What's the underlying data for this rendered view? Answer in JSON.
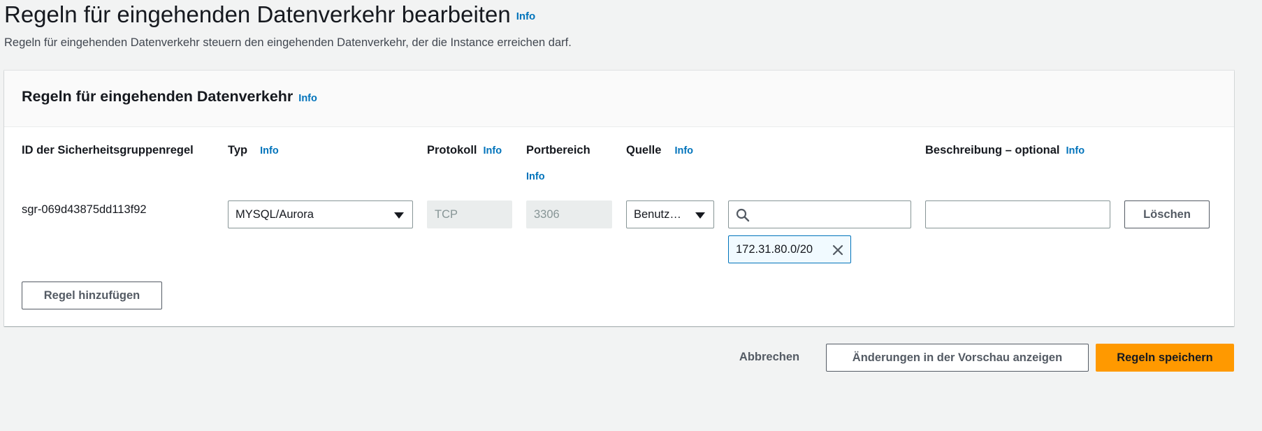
{
  "page": {
    "title": "Regeln für eingehenden Datenverkehr bearbeiten",
    "title_info": "Info",
    "description": "Regeln für eingehenden Datenverkehr steuern den eingehenden Datenverkehr, der die Instance erreichen darf."
  },
  "panel": {
    "title": "Regeln für eingehenden Datenverkehr",
    "title_info": "Info",
    "columns": {
      "rule_id": "ID der Sicherheitsgruppenregel",
      "type": "Typ",
      "type_info": "Info",
      "protocol": "Protokoll",
      "protocol_info": "Info",
      "port_range": "Portbereich",
      "port_range_info": "Info",
      "source": "Quelle",
      "source_info": "Info",
      "description": "Beschreibung – optional",
      "description_info": "Info"
    },
    "rule": {
      "id": "sgr-069d43875dd113f92",
      "type": "MYSQL/Aurora",
      "protocol": "TCP",
      "port_range": "3306",
      "source_type": "Benutz…",
      "source_search_value": "",
      "source_token": "172.31.80.0/20",
      "description_value": "",
      "delete_label": "Löschen"
    },
    "add_rule_label": "Regel hinzufügen"
  },
  "footer": {
    "cancel_label": "Abbrechen",
    "preview_label": "Änderungen in der Vorschau anzeigen",
    "save_label": "Regeln speichern"
  },
  "colors": {
    "primary": "#ff9900",
    "link": "#0073bb",
    "background": "#f2f3f3"
  }
}
